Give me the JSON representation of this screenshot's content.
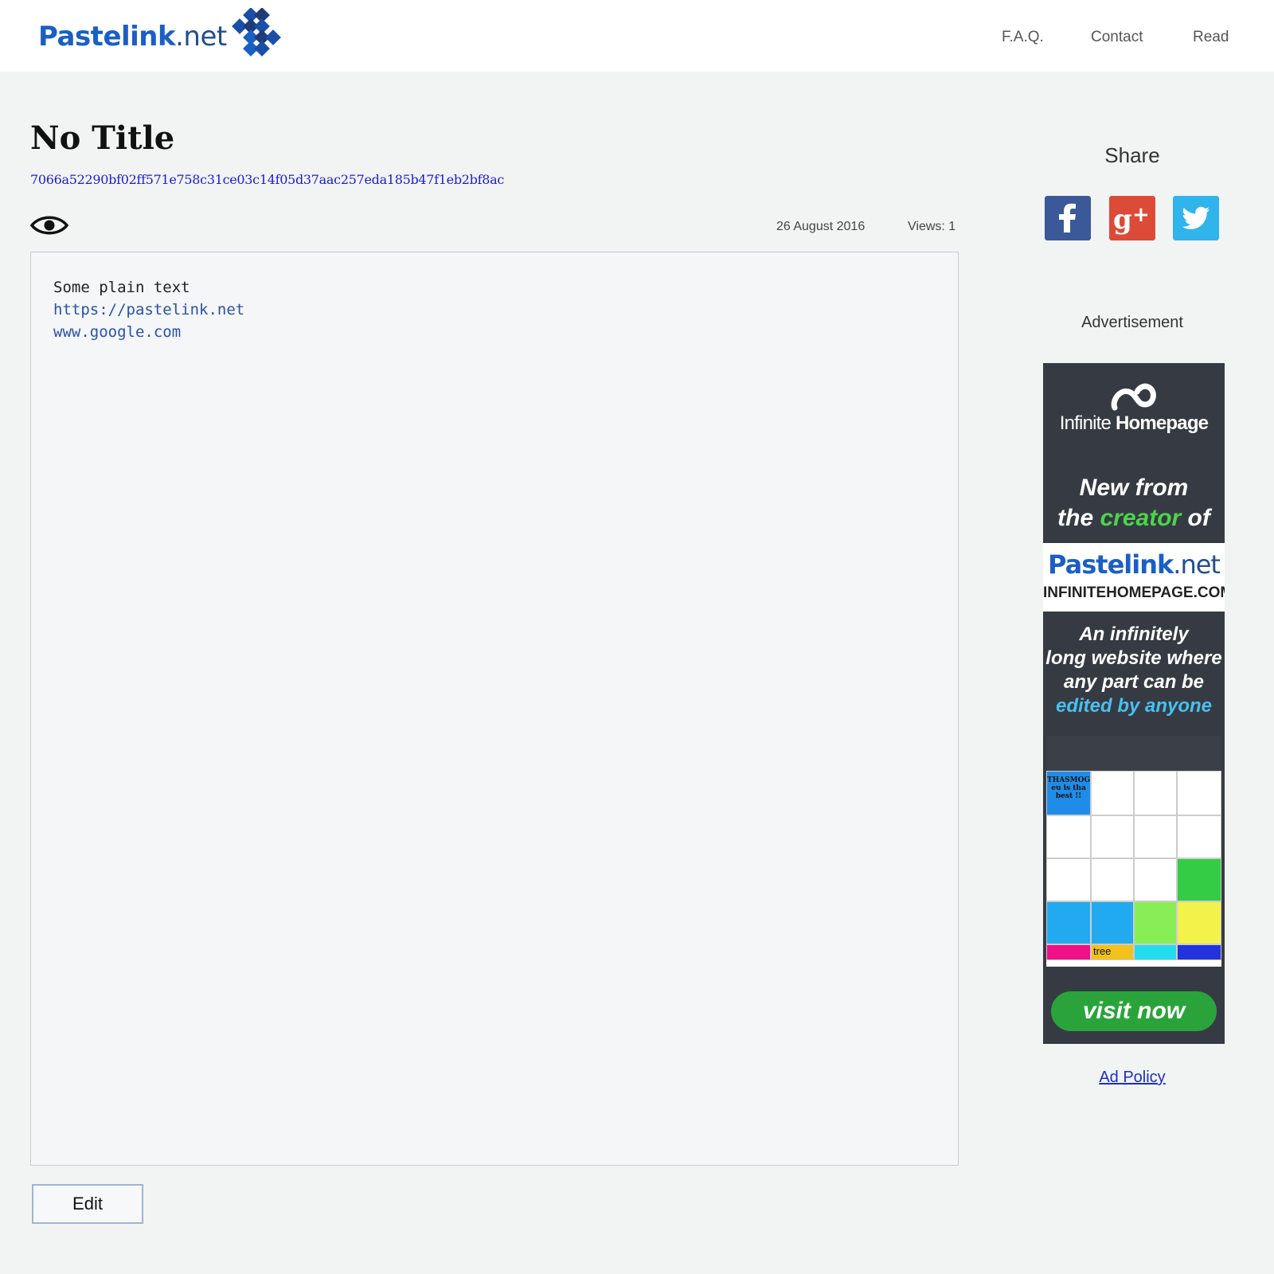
{
  "header": {
    "logo_bold": "Pastelink",
    "logo_light": ".net",
    "nav": {
      "faq": "F.A.Q.",
      "contact": "Contact",
      "read": "Read"
    }
  },
  "paste": {
    "title": "No Title",
    "hash": "7066a52290bf02ff571e758c31ce03c14f05d37aac257eda185b47f1eb2bf8ac",
    "date": "26 August 2016",
    "views": "Views: 1",
    "lines": [
      "Some plain text",
      "",
      "https://pastelink.net",
      "www.google.com"
    ],
    "edit_label": "Edit"
  },
  "sidebar": {
    "share_title": "Share",
    "advertisement_label": "Advertisement",
    "ad_policy": "Ad Policy",
    "social_icons": [
      "facebook-icon",
      "google-plus-icon",
      "twitter-icon"
    ],
    "social_colors": {
      "facebook": "#3b5998",
      "google_plus": "#dc4a38",
      "twitter": "#2fb4ec"
    }
  },
  "ad": {
    "brand_light": "Infinite ",
    "brand_bold": "Homepage",
    "new_from": "New from",
    "the": "the ",
    "creator": "creator",
    "of": " of",
    "pastelink_bold": "Pastelink",
    "pastelink_light": ".net",
    "url": "INFINITEHOMEPAGE.COM",
    "desc_line1": "An infinitely",
    "desc_line2": "long website where",
    "desc_line3": "any part can be",
    "desc_highlight": "edited by anyone",
    "shot_cell_text": "THASMOG eu is tha best !!",
    "shot_tree": "tree",
    "visit_label": "visit now"
  },
  "colors": {
    "link": "#1b1bd6",
    "brand_blue": "#1a5fc4",
    "ad_bg": "#363b43",
    "visit_green": "#2aa43a"
  }
}
